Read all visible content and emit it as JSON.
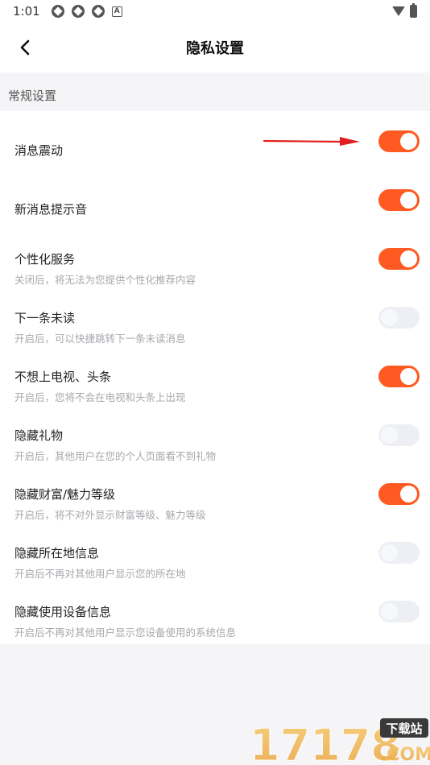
{
  "status_bar": {
    "time": "1:01",
    "notification_icons": [
      "app-icon",
      "app-icon",
      "app-icon",
      "a-icon"
    ],
    "right_icons": [
      "wifi-icon",
      "battery-icon"
    ]
  },
  "header": {
    "title": "隐私设置",
    "back_icon": "chevron-left-icon"
  },
  "section": {
    "label": "常规设置"
  },
  "settings": [
    {
      "title": "消息震动",
      "desc": "",
      "on": true
    },
    {
      "title": "新消息提示音",
      "desc": "",
      "on": true
    },
    {
      "title": "个性化服务",
      "desc": "关闭后，将无法为您提供个性化推荐内容",
      "on": true
    },
    {
      "title": "下一条未读",
      "desc": "开启后，可以快捷跳转下一条未读消息",
      "on": false
    },
    {
      "title": "不想上电视、头条",
      "desc": "开启后，您将不会在电视和头条上出现",
      "on": true
    },
    {
      "title": "隐藏礼物",
      "desc": "开启后，其他用户在您的个人页面看不到礼物",
      "on": false
    },
    {
      "title": "隐藏财富/魅力等级",
      "desc": "开启后，将不对外显示财富等级、魅力等级",
      "on": true
    },
    {
      "title": "隐藏所在地信息",
      "desc": "开启后不再对其他用户显示您的所在地",
      "on": false
    },
    {
      "title": "隐藏使用设备信息",
      "desc": "开启后不再对其他用户显示您设备使用的系统信息",
      "on": false
    }
  ],
  "watermark": {
    "logo_text": "17178",
    "badge_text": "下载站",
    "domain_text": ".COM"
  },
  "colors": {
    "accent": "#ff5a22",
    "toggle_off": "#eeeff5",
    "annotation_arrow": "#e02020"
  }
}
